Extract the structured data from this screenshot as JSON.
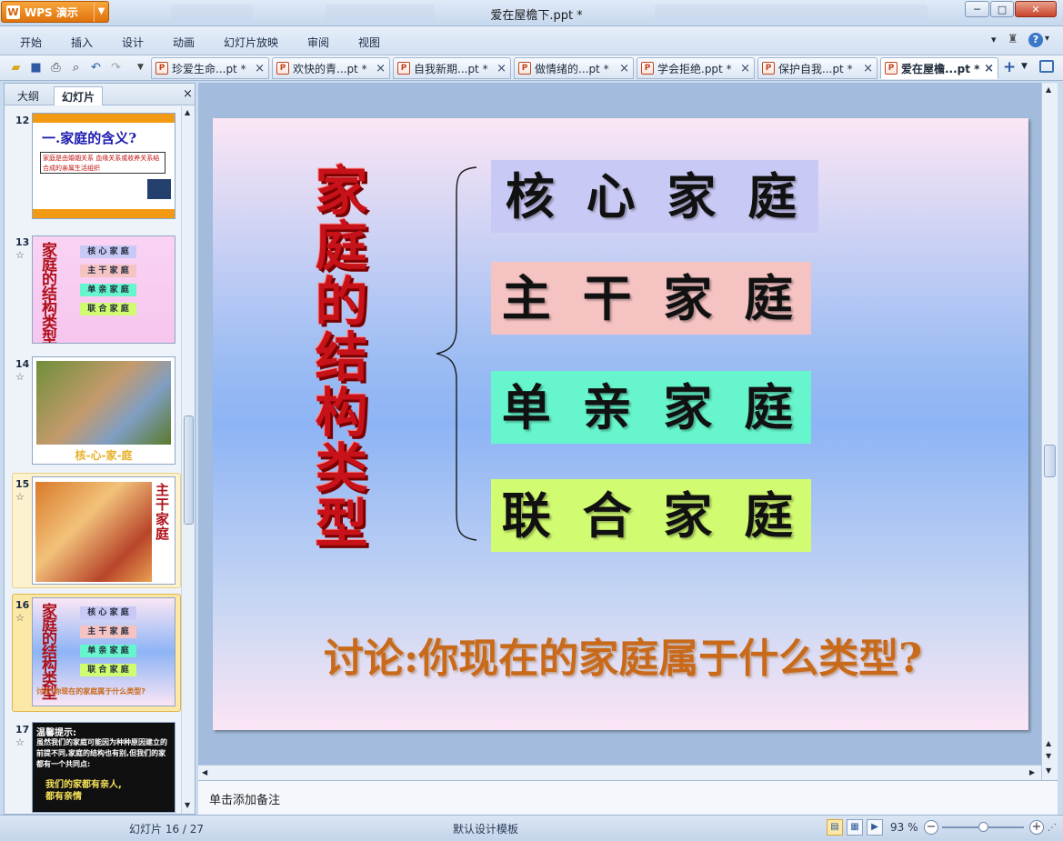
{
  "window": {
    "app_button": "WPS 演示",
    "doc_title": "爱在屋檐下.ppt *",
    "min_label": "─",
    "max_label": "□",
    "close_label": "✕"
  },
  "menu": {
    "items": [
      "开始",
      "插入",
      "设计",
      "动画",
      "幻灯片放映",
      "审阅",
      "视图"
    ]
  },
  "doc_tabs": [
    {
      "label": "珍爱生命...pt *"
    },
    {
      "label": "欢快的青...pt *"
    },
    {
      "label": "自我新期...pt *"
    },
    {
      "label": "做情绪的...pt *"
    },
    {
      "label": "学会拒绝.ppt *"
    },
    {
      "label": "保护自我...pt *"
    },
    {
      "label": "爱在屋檐...pt *"
    }
  ],
  "panel": {
    "tab_outline": "大纲",
    "tab_slides": "幻灯片",
    "close": "×"
  },
  "thumbs": {
    "n12": "12",
    "n13": "13",
    "n14": "14",
    "n15": "15",
    "n16": "16",
    "n17": "17",
    "t12_title": "一.家庭的含义?",
    "t12_body": "家庭是由婚姻关系 血缘关系或收养关系结合成的亲属生活组织",
    "t14_caption": "核-心-家-庭",
    "t15_title": "主干家庭",
    "t17_head": "温馨提示:",
    "t17_body": "虽然我们的家庭可能因为种种原因建立的前提不同,家庭的结构也有别,但我们的家都有一个共同点:",
    "t17_foot": "我们的家都有亲人,都有亲情",
    "mini_title": "家庭的结构类型",
    "mini_items": [
      "核 心 家 庭",
      "主 干 家 庭",
      "单 亲 家 庭",
      "联 合 家 庭"
    ],
    "mini_question": "讨论:你现在的家庭属于什么类型?",
    "star": "☆"
  },
  "slide": {
    "vertical_title": [
      "家",
      "庭",
      "的",
      "结",
      "构",
      "类",
      "型"
    ],
    "boxes": [
      {
        "label": "核 心 家 庭",
        "color": "#c9c9f5"
      },
      {
        "label": "主 干 家 庭",
        "color": "#f6c3c3"
      },
      {
        "label": "单 亲 家 庭",
        "color": "#66f5cc"
      },
      {
        "label": "联 合 家 庭",
        "color": "#d1fb70"
      }
    ],
    "question": "讨论:你现在的家庭属于什么类型?"
  },
  "notes": {
    "placeholder": "单击添加备注"
  },
  "status": {
    "slide_pos": "幻灯片 16 / 27",
    "template": "默认设计模板",
    "zoom": "93 %",
    "zoom_level": 0.5
  },
  "colors": {
    "accent": "#2d5aa0",
    "wps_orange": "#e0720c"
  }
}
